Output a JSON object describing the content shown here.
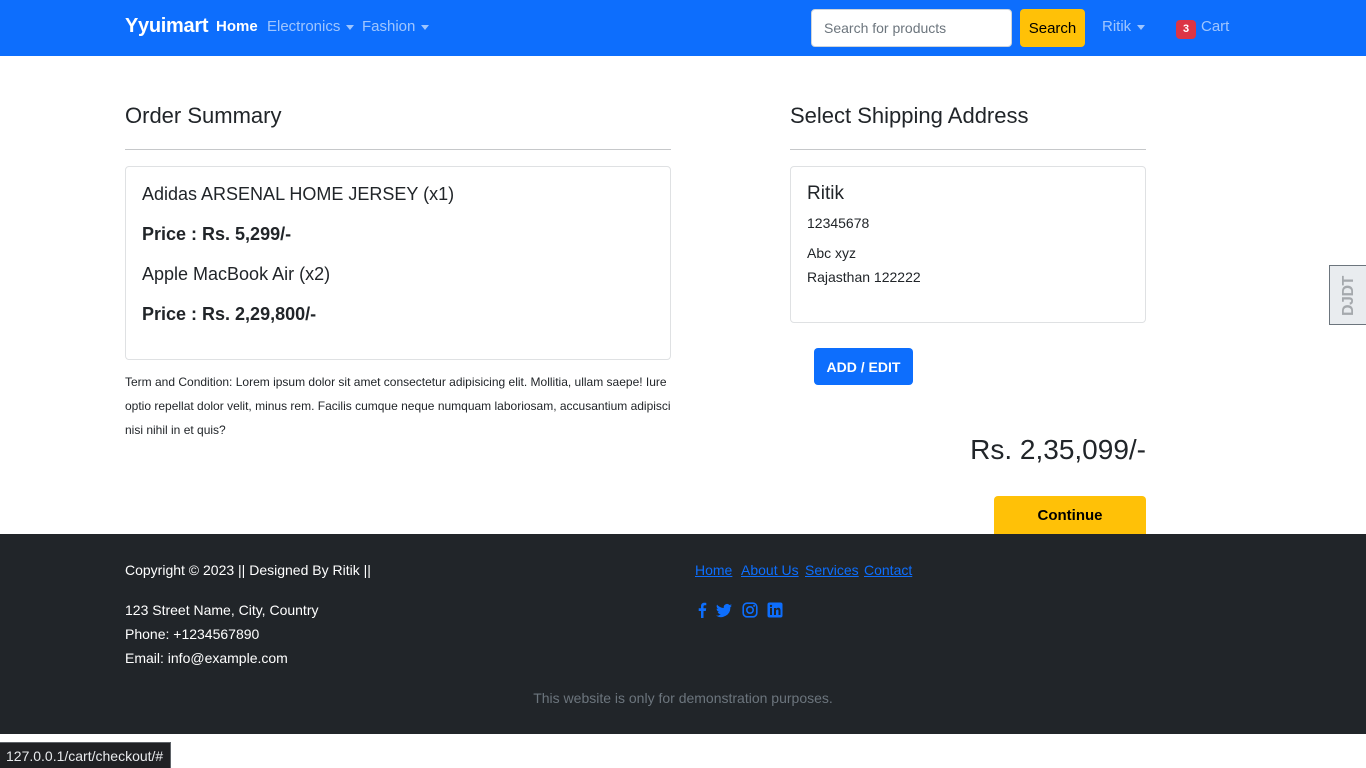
{
  "navbar": {
    "brand": "Yyuimart",
    "home": "Home",
    "electronics": "Electronics",
    "fashion": "Fashion",
    "search_placeholder": "Search for products",
    "search_button": "Search",
    "user": "Ritik",
    "cart_count": "3",
    "cart": "Cart"
  },
  "order_summary": {
    "title": "Order Summary",
    "items": [
      {
        "name": "Adidas ARSENAL HOME JERSEY (x1)",
        "price": "Price : Rs. 5,299/-"
      },
      {
        "name": "Apple MacBook Air (x2)",
        "price": "Price : Rs. 2,29,800/-"
      }
    ],
    "terms": "Term and Condition: Lorem ipsum dolor sit amet consectetur adipisicing elit. Mollitia, ullam saepe! Iure optio repellat dolor velit, minus rem. Facilis cumque neque numquam laboriosam, accusantium adipisci nisi nihil in et quis?"
  },
  "shipping": {
    "title": "Select Shipping Address",
    "name": "Ritik",
    "phone": "12345678",
    "line1": "Abc xyz",
    "line2": "Rajasthan 122222",
    "add_edit_button": "ADD / EDIT"
  },
  "total": "Rs. 2,35,099/-",
  "continue_button": "Continue",
  "djdt": "DJDT",
  "footer": {
    "copyright": "Copyright © 2023 || Designed By Ritik ||",
    "address": "123 Street Name, City, Country",
    "phone": "Phone: +1234567890",
    "email": "Email: info@example.com",
    "links": [
      "Home",
      "About Us",
      "Services",
      "Contact"
    ],
    "social_icons": [
      "facebook-icon",
      "twitter-icon",
      "instagram-icon",
      "linkedin-icon"
    ],
    "note": "This website is only for demonstration purposes."
  },
  "status_url": "127.0.0.1/cart/checkout/#",
  "colors": {
    "primary": "#0d6efd",
    "warning": "#ffc107",
    "danger": "#dc3545",
    "footer_bg": "#212529"
  }
}
